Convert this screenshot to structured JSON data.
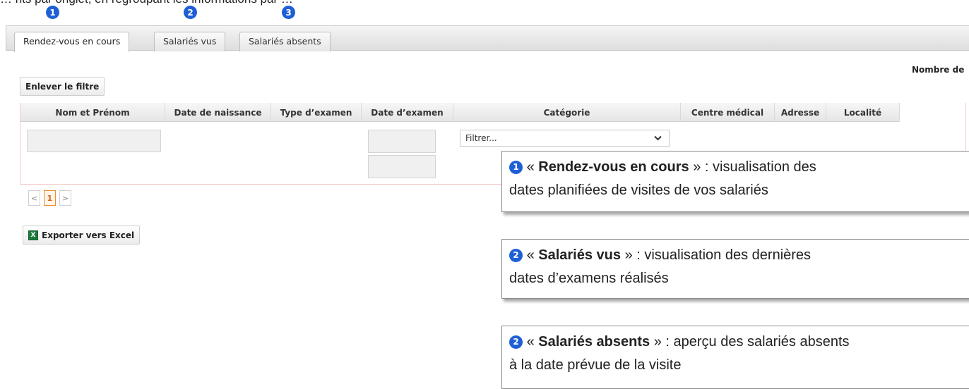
{
  "intro_text": "… nts par onglet, en regroupant les informations par …",
  "markers": [
    "1",
    "2",
    "3"
  ],
  "tabs": [
    {
      "label": "Rendez-vous en cours",
      "active": true
    },
    {
      "label": "Salariés vus",
      "active": false
    },
    {
      "label": "Salariés absents",
      "active": false
    }
  ],
  "count_label": "Nombre de",
  "remove_filter_label": "Enlever le filtre",
  "columns": [
    "Nom et Prénom",
    "Date de naissance",
    "Type d’examen",
    "Date d’examen",
    "Catégorie",
    "Centre médical",
    "Adresse",
    "Localité"
  ],
  "category_filter": {
    "value": "Filtrer..."
  },
  "pager": {
    "prev": "<",
    "current": "1",
    "next": ">"
  },
  "export_label": "Exporter vers Excel",
  "icons": {
    "excel": "excel-icon",
    "dropdown": "chevron-down-icon"
  },
  "callouts": [
    {
      "num": "1",
      "open": "«",
      "title": "Rendez-vous en cours",
      "close": "»",
      "line1": " : visualisation des",
      "line2": "dates planifiées de visites de vos salariés"
    },
    {
      "num": "2",
      "open": "«",
      "title": "Salariés vus",
      "close": "»",
      "line1": " : visualisation des dernières",
      "line2": "dates d’examens réalisés"
    },
    {
      "num": "2",
      "open": "«",
      "title": "Salariés absents",
      "close": "»",
      "line1": " : aperçu des salariés absents",
      "line2": "à la date prévue de la visite"
    }
  ],
  "colors": {
    "marker": "#1f5fd6",
    "pager_current": "#f08a24",
    "grid_border": "#f1c9c9"
  }
}
